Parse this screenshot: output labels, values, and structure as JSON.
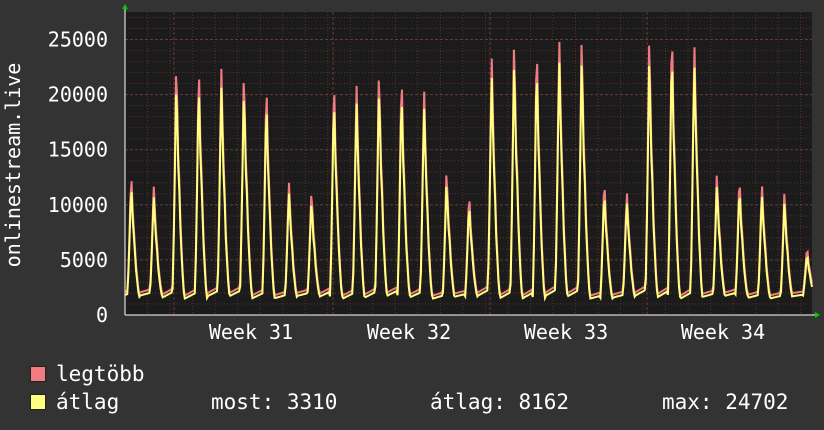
{
  "chart_data": {
    "type": "line",
    "ylabel": "onlinestream.live",
    "ylim": [
      0,
      27500
    ],
    "yticks": [
      0,
      5000,
      10000,
      15000,
      20000,
      25000
    ],
    "xticks": [
      "Week 31",
      "Week 32",
      "Week 33",
      "Week 34"
    ],
    "grid": true,
    "legend_position": "bottom-left",
    "days": 29,
    "daily_peaks_max": [
      12800,
      11800,
      22800,
      22700,
      22700,
      22000,
      21000,
      12200,
      11200,
      21300,
      21200,
      22000,
      21900,
      20700,
      13000,
      11000,
      23800,
      24600,
      24600,
      25400,
      24900,
      12200,
      11300,
      24700,
      26000,
      25000,
      12700,
      12500,
      12000,
      11000,
      6100
    ],
    "series": [
      {
        "name": "legtöbb",
        "color": "#f07b81"
      },
      {
        "name": "átlag",
        "color": "#ffff80"
      }
    ]
  },
  "legend": {
    "max_label": "legtöbb",
    "avg_label": "átlag",
    "now": "most: 3310",
    "average": "átlag: 8162",
    "maximum": "max: 24702"
  },
  "colors": {
    "background": "#333333",
    "plot_background": "#1b1b1b",
    "grid_minor": "#5a3030",
    "grid_major": "#6a3a3a",
    "axis": "#ffffff",
    "arrow": "#00cc00"
  }
}
